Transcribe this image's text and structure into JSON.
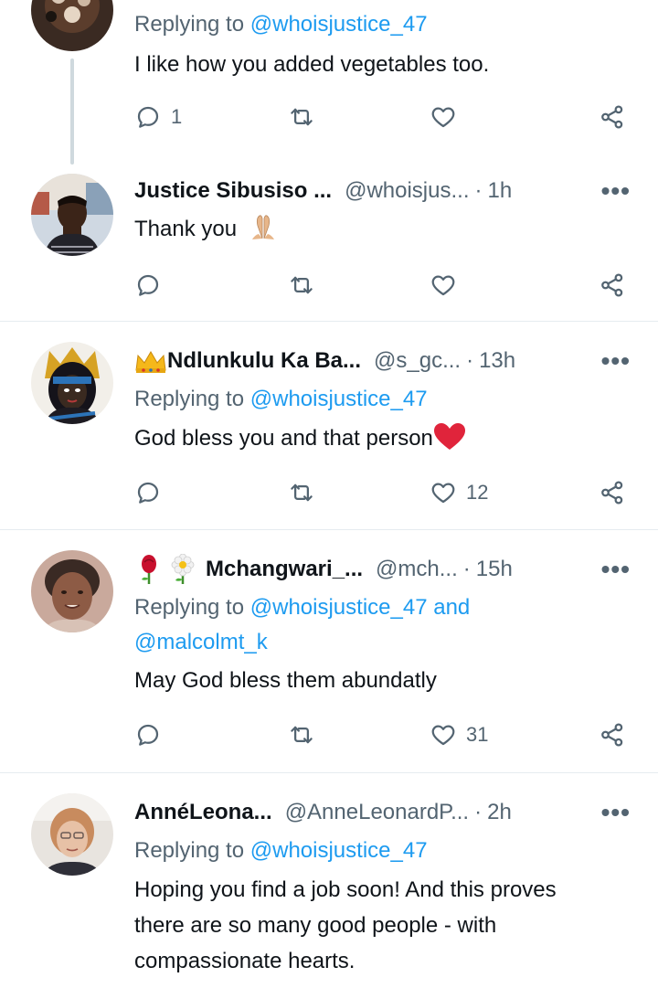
{
  "tweets": [
    {
      "replying_prefix": "Replying to",
      "replying_to": "@whoisjustice_47",
      "text": "I like how you added vegetables too.",
      "reply_count": "1",
      "like_count": ""
    },
    {
      "name": "Justice Sibusiso ...",
      "handle": "@whoisjus...",
      "dot": "·",
      "time": "1h",
      "text": "Thank you",
      "text_emoji": "folded-hands-emoji"
    },
    {
      "name_emoji": "crown-emoji",
      "name": "Ndlunkulu Ka Ba...",
      "handle": "@s_gc...",
      "dot": "·",
      "time": "13h",
      "replying_prefix": "Replying to",
      "replying_to": "@whoisjustice_47",
      "text": "God bless you and that person",
      "text_emoji": "red-heart-emoji",
      "like_count": "12"
    },
    {
      "name_emojis": [
        "rose-emoji",
        "blossom-emoji"
      ],
      "name": "Mchangwari_...",
      "handle": "@mch...",
      "dot": "·",
      "time": "15h",
      "replying_prefix": "Replying to",
      "replying_to": "@whoisjustice_47",
      "replying_and": "and",
      "replying_to_2": "@malcolmt_k",
      "text": "May God bless them abundatly",
      "like_count": "31"
    },
    {
      "name": "AnnéLeona...",
      "handle": "@AnneLeonardP...",
      "dot": "·",
      "time": "2h",
      "replying_prefix": "Replying to",
      "replying_to": "@whoisjustice_47",
      "text_line_1": "Hoping you find a job soon! And this proves",
      "text_line_2": "there are so many good people - with",
      "text_line_3": "compassionate hearts."
    }
  ],
  "more_label": "•••",
  "icons": {
    "reply": "reply-icon",
    "retweet": "retweet-icon",
    "like": "heart-icon",
    "share": "share-icon",
    "more": "more-icon"
  },
  "colors": {
    "link": "#1d9bf0",
    "secondary_text": "#536471",
    "primary_text": "#0f1419",
    "divider": "#e6ecf0"
  }
}
